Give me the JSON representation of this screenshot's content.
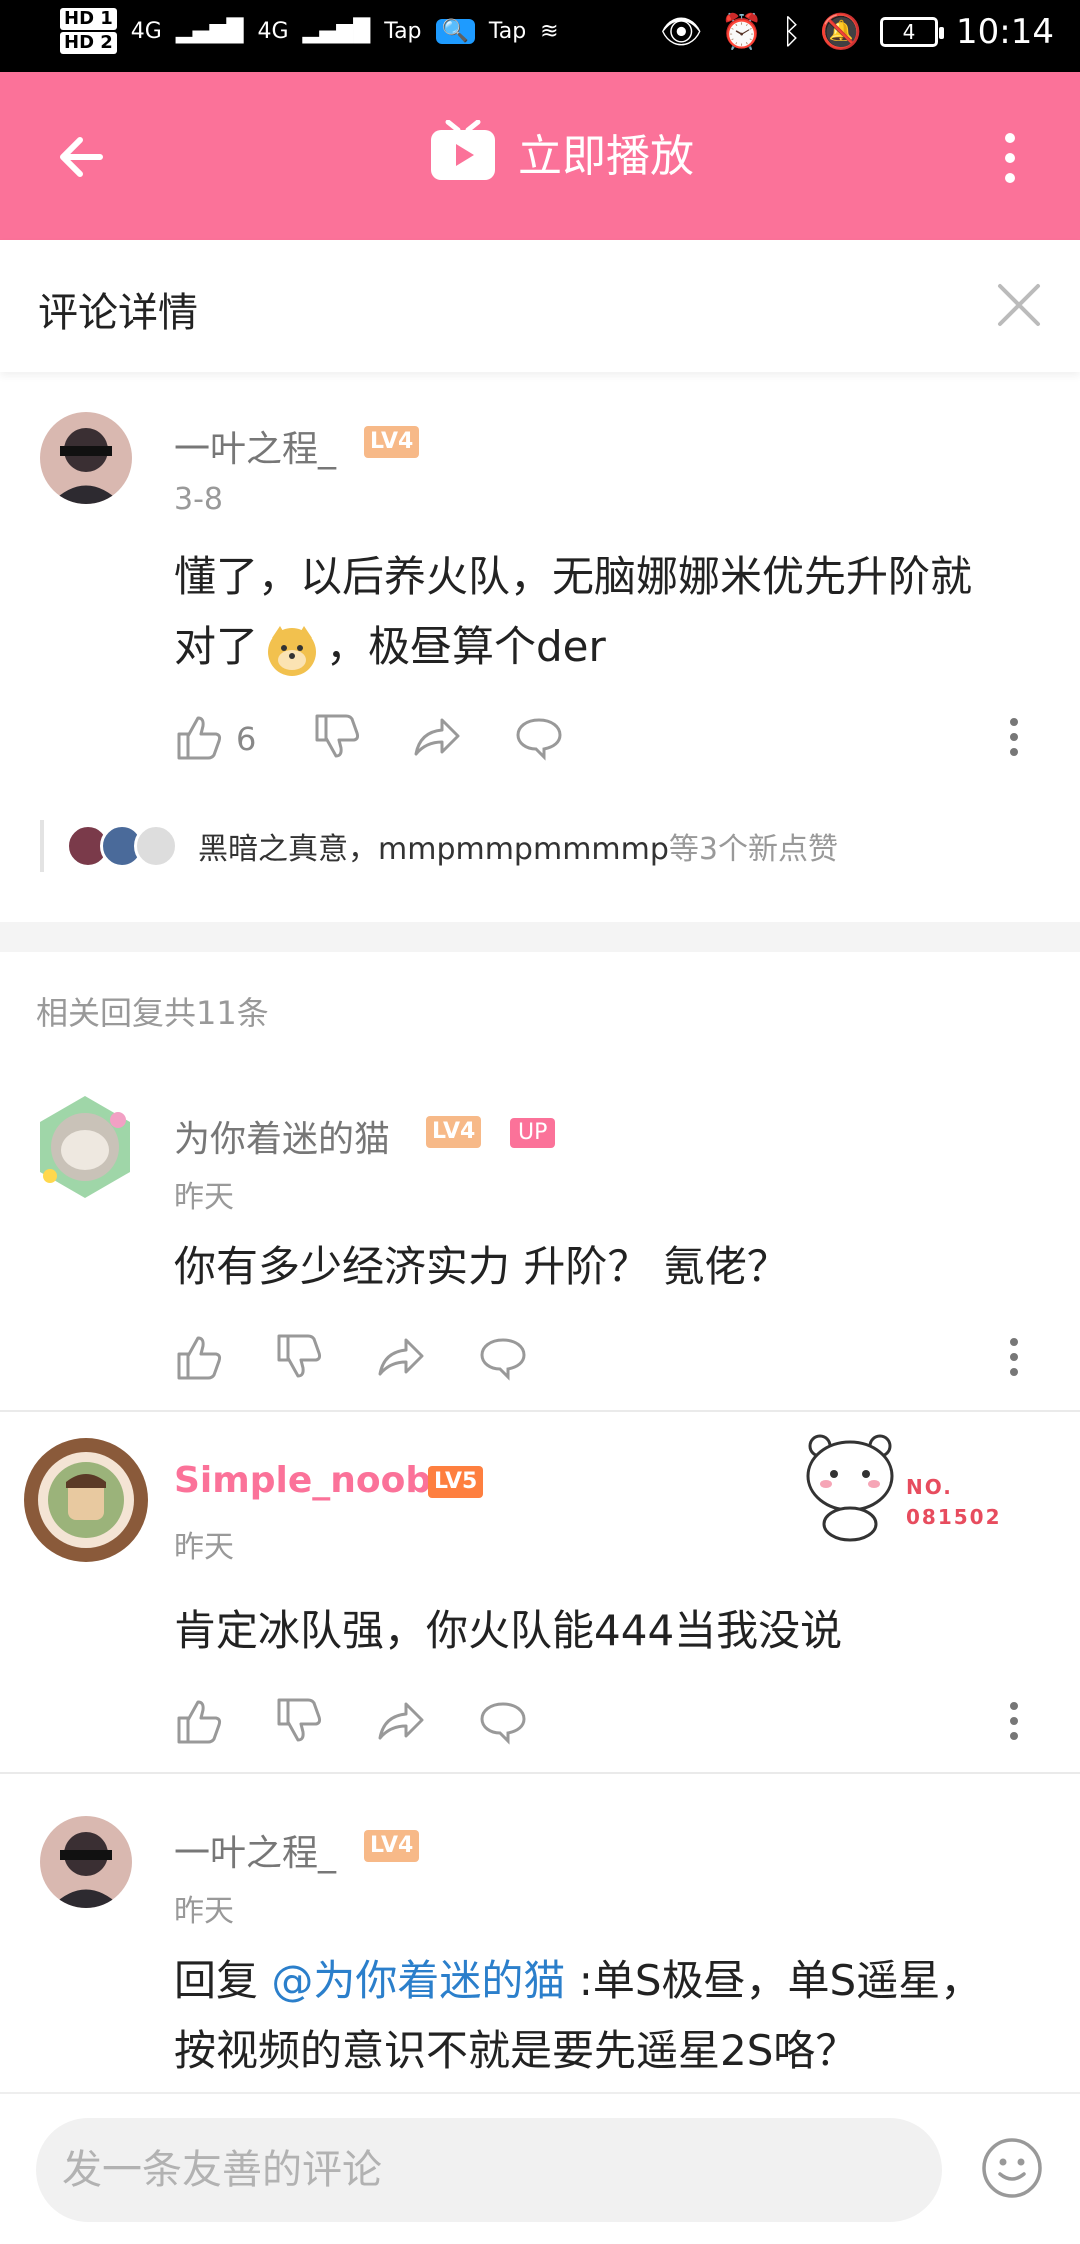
{
  "status_bar": {
    "hd1": "HD 1",
    "hd2": "HD 2",
    "net1": "4G",
    "net2": "4G",
    "app1": "Tap",
    "app2": "Tap",
    "battery": "4",
    "time": "10:14"
  },
  "topbar": {
    "play_label": "立即播放"
  },
  "sheet": {
    "title": "评论详情"
  },
  "main_comment": {
    "user": "一叶之程_",
    "level": "LV4",
    "date": "3-8",
    "text_line1": "懂了，以后养火队，无脑娜娜米优先升阶就",
    "text_line2_a": "对了",
    "text_line2_b": "，极昼算个der",
    "likes": "6",
    "likers_names": "黑暗之真意，mmpmmpmmmmp",
    "likers_tail": " 等3个新点赞"
  },
  "replies_header": "相关回复共11条",
  "replies": [
    {
      "user": "为你着迷的猫",
      "level": "LV4",
      "badge": "UP",
      "date": "昨天",
      "text": "你有多少经济实力 升阶？ 氪佬？"
    },
    {
      "user": "Simple_noob",
      "level": "LV5",
      "date": "昨天",
      "text": "肯定冰队强，你火队能444当我没说",
      "medal_line1": "NO.",
      "medal_line2": "081502"
    },
    {
      "user": "一叶之程_",
      "level": "LV4",
      "date": "昨天",
      "prefix": "回复 ",
      "mention": "@为你着迷的猫",
      "text_rest": " :单S极昼，单S遥星，",
      "text_line2": "按视频的意识不就是要先遥星2S咯？"
    }
  ],
  "bottom_bar": {
    "input_placeholder": "发一条友善的评论"
  }
}
